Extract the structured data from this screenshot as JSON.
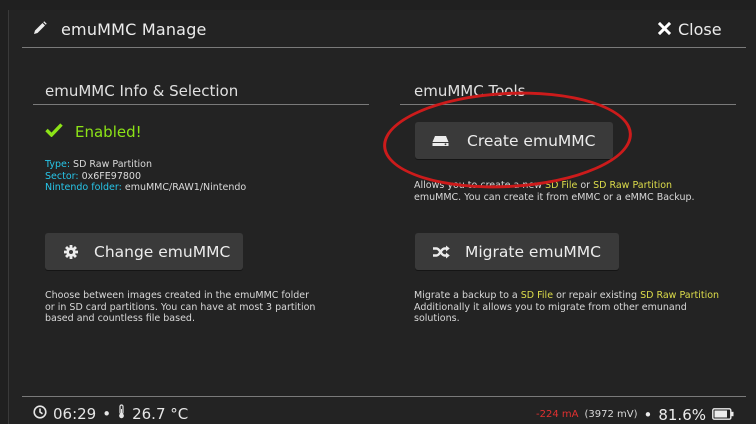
{
  "header": {
    "title": "emuMMC Manage",
    "close_label": "Close"
  },
  "left": {
    "title": "emuMMC Info & Selection",
    "status": "Enabled!",
    "info": [
      {
        "key": "Type:",
        "value": " SD Raw Partition"
      },
      {
        "key": "Sector:",
        "value": " 0x6FE97800"
      },
      {
        "key": "Nintendo folder:",
        "value": " emuMMC/RAW1/Nintendo"
      }
    ],
    "change_button": "Change emuMMC",
    "desc": [
      "Choose between images created in the emuMMC folder",
      "or in SD card partitions. You can have at most 3 partition",
      "based and countless file based."
    ]
  },
  "right": {
    "title": "emuMMC Tools",
    "create_button": "Create emuMMC",
    "create_desc": {
      "p1": "Allows you to create a new ",
      "hl1": "SD File",
      "p2": " or ",
      "hl2": "SD Raw Partition",
      "line2": "emuMMC. You can create it from eMMC or a eMMC Backup."
    },
    "migrate_button": "Migrate emuMMC",
    "migrate_desc": {
      "p1": "Migrate a backup to a ",
      "hl1": "SD File",
      "p2": " or repair existing ",
      "hl2": "SD Raw Partition",
      "line2": "Additionally it allows you to migrate from other emunand",
      "line3": "solutions."
    }
  },
  "footer": {
    "time": "06:29",
    "sep": "•",
    "temp": "26.7 °C",
    "current": "-224 mA",
    "voltage": "(3972 mV)",
    "battery": "81.6%"
  },
  "colors": {
    "enabled": "#8ce317",
    "info_key": "#27c5e8",
    "highlight": "#dcdc4a",
    "annotation": "#cc1b1b"
  }
}
